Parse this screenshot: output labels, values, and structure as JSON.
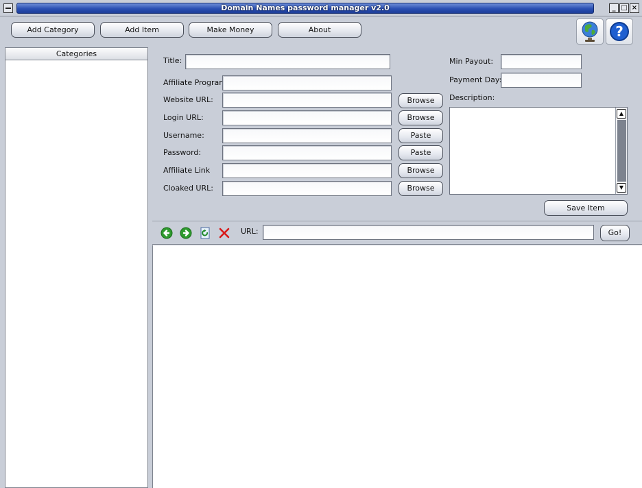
{
  "window": {
    "title": "Domain Names password manager v2.0",
    "controls": {
      "minimize_glyph": "_",
      "maximize_glyph": "□",
      "close_glyph": "×"
    }
  },
  "toolbar": {
    "add_category": "Add Category",
    "add_item": "Add Item",
    "make_money": "Make Money",
    "about": "About",
    "icons": [
      "globe-icon",
      "help-icon"
    ]
  },
  "categories": {
    "header": "Categories",
    "items": []
  },
  "form": {
    "title_label": "Title:",
    "title_value": "",
    "affiliate_program_label": "Affiliate Program:",
    "affiliate_program_value": "",
    "website_url_label": "Website URL:",
    "website_url_value": "",
    "login_url_label": "Login URL:",
    "login_url_value": "",
    "username_label": "Username:",
    "username_value": "",
    "password_label": "Password:",
    "password_value": "",
    "affiliate_link_label": "Affiliate Link",
    "affiliate_link_value": "",
    "cloaked_url_label": "Cloaked URL:",
    "cloaked_url_value": "",
    "browse_label": "Browse",
    "paste_label": "Paste",
    "min_payout_label": "Min Payout:",
    "min_payout_value": "",
    "payment_day_label": "Payment Day:",
    "payment_day_value": "",
    "description_label": "Description:",
    "description_value": "",
    "save_item_label": "Save Item"
  },
  "browser": {
    "url_label": "URL:",
    "url_value": "",
    "go_label": "Go!",
    "nav_icons": [
      "back-icon",
      "forward-icon",
      "refresh-icon",
      "stop-icon"
    ]
  },
  "colors": {
    "window_bg": "#c9ced8",
    "title_bar": "#2a4fb3",
    "back_forward_green": "#2e9a2e",
    "stop_red": "#d81818",
    "help_blue": "#1f5fd0"
  }
}
